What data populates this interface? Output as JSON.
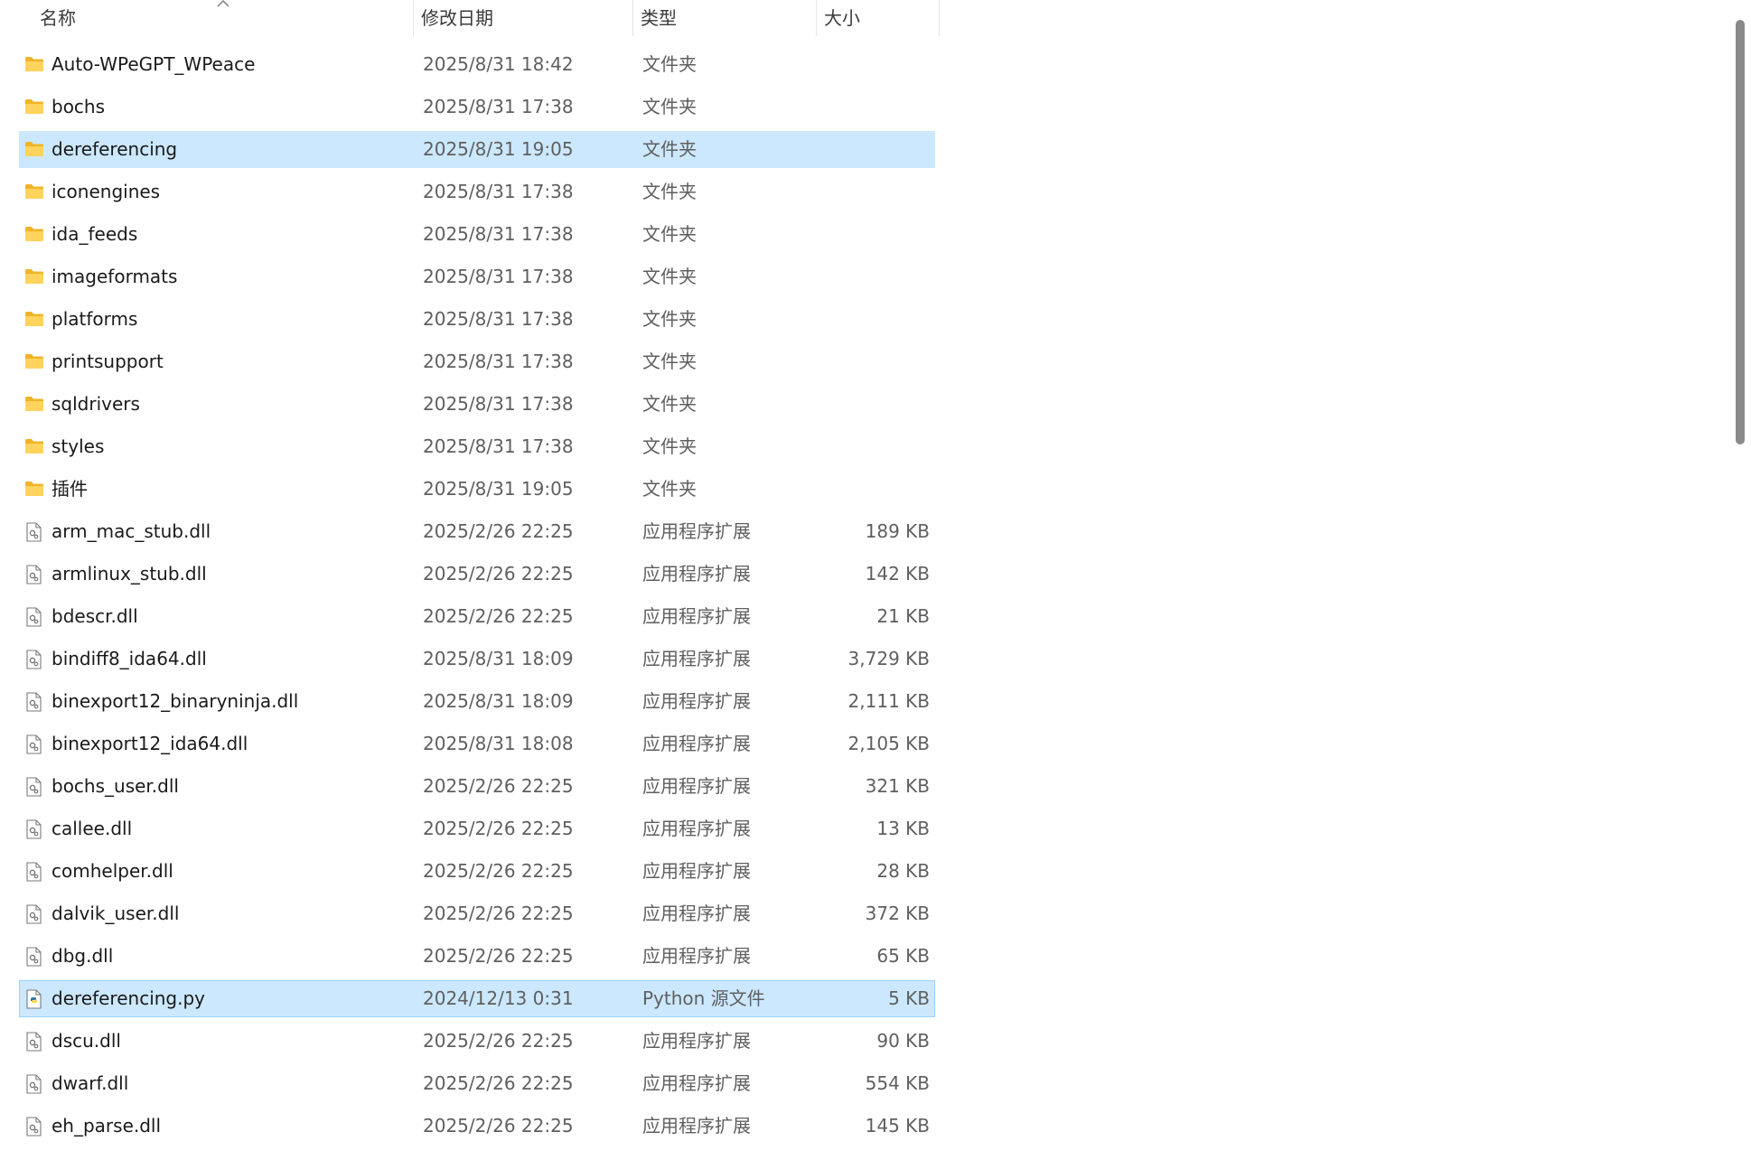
{
  "columns": {
    "name": "名称",
    "date": "修改日期",
    "type": "类型",
    "size": "大小"
  },
  "files": [
    {
      "name": "Auto-WPeGPT_WPeace",
      "date": "2025/8/31 18:42",
      "type": "文件夹",
      "size": "",
      "icon": "folder-icon",
      "state": ""
    },
    {
      "name": "bochs",
      "date": "2025/8/31 17:38",
      "type": "文件夹",
      "size": "",
      "icon": "folder-icon",
      "state": ""
    },
    {
      "name": "dereferencing",
      "date": "2025/8/31 19:05",
      "type": "文件夹",
      "size": "",
      "icon": "folder-icon",
      "state": "selected"
    },
    {
      "name": "iconengines",
      "date": "2025/8/31 17:38",
      "type": "文件夹",
      "size": "",
      "icon": "folder-icon",
      "state": ""
    },
    {
      "name": "ida_feeds",
      "date": "2025/8/31 17:38",
      "type": "文件夹",
      "size": "",
      "icon": "folder-icon",
      "state": ""
    },
    {
      "name": "imageformats",
      "date": "2025/8/31 17:38",
      "type": "文件夹",
      "size": "",
      "icon": "folder-icon",
      "state": ""
    },
    {
      "name": "platforms",
      "date": "2025/8/31 17:38",
      "type": "文件夹",
      "size": "",
      "icon": "folder-icon",
      "state": ""
    },
    {
      "name": "printsupport",
      "date": "2025/8/31 17:38",
      "type": "文件夹",
      "size": "",
      "icon": "folder-icon",
      "state": ""
    },
    {
      "name": "sqldrivers",
      "date": "2025/8/31 17:38",
      "type": "文件夹",
      "size": "",
      "icon": "folder-icon",
      "state": ""
    },
    {
      "name": "styles",
      "date": "2025/8/31 17:38",
      "type": "文件夹",
      "size": "",
      "icon": "folder-icon",
      "state": ""
    },
    {
      "name": "插件",
      "date": "2025/8/31 19:05",
      "type": "文件夹",
      "size": "",
      "icon": "folder-icon",
      "state": ""
    },
    {
      "name": "arm_mac_stub.dll",
      "date": "2025/2/26 22:25",
      "type": "应用程序扩展",
      "size": "189 KB",
      "icon": "dll-file-icon",
      "state": ""
    },
    {
      "name": "armlinux_stub.dll",
      "date": "2025/2/26 22:25",
      "type": "应用程序扩展",
      "size": "142 KB",
      "icon": "dll-file-icon",
      "state": ""
    },
    {
      "name": "bdescr.dll",
      "date": "2025/2/26 22:25",
      "type": "应用程序扩展",
      "size": "21 KB",
      "icon": "dll-file-icon",
      "state": ""
    },
    {
      "name": "bindiff8_ida64.dll",
      "date": "2025/8/31 18:09",
      "type": "应用程序扩展",
      "size": "3,729 KB",
      "icon": "dll-file-icon",
      "state": ""
    },
    {
      "name": "binexport12_binaryninja.dll",
      "date": "2025/8/31 18:09",
      "type": "应用程序扩展",
      "size": "2,111 KB",
      "icon": "dll-file-icon",
      "state": ""
    },
    {
      "name": "binexport12_ida64.dll",
      "date": "2025/8/31 18:08",
      "type": "应用程序扩展",
      "size": "2,105 KB",
      "icon": "dll-file-icon",
      "state": ""
    },
    {
      "name": "bochs_user.dll",
      "date": "2025/2/26 22:25",
      "type": "应用程序扩展",
      "size": "321 KB",
      "icon": "dll-file-icon",
      "state": ""
    },
    {
      "name": "callee.dll",
      "date": "2025/2/26 22:25",
      "type": "应用程序扩展",
      "size": "13 KB",
      "icon": "dll-file-icon",
      "state": ""
    },
    {
      "name": "comhelper.dll",
      "date": "2025/2/26 22:25",
      "type": "应用程序扩展",
      "size": "28 KB",
      "icon": "dll-file-icon",
      "state": ""
    },
    {
      "name": "dalvik_user.dll",
      "date": "2025/2/26 22:25",
      "type": "应用程序扩展",
      "size": "372 KB",
      "icon": "dll-file-icon",
      "state": ""
    },
    {
      "name": "dbg.dll",
      "date": "2025/2/26 22:25",
      "type": "应用程序扩展",
      "size": "65 KB",
      "icon": "dll-file-icon",
      "state": ""
    },
    {
      "name": "dereferencing.py",
      "date": "2024/12/13 0:31",
      "type": "Python 源文件",
      "size": "5 KB",
      "icon": "python-file-icon",
      "state": "focused"
    },
    {
      "name": "dscu.dll",
      "date": "2025/2/26 22:25",
      "type": "应用程序扩展",
      "size": "90 KB",
      "icon": "dll-file-icon",
      "state": ""
    },
    {
      "name": "dwarf.dll",
      "date": "2025/2/26 22:25",
      "type": "应用程序扩展",
      "size": "554 KB",
      "icon": "dll-file-icon",
      "state": ""
    },
    {
      "name": "eh_parse.dll",
      "date": "2025/2/26 22:25",
      "type": "应用程序扩展",
      "size": "145 KB",
      "icon": "dll-file-icon",
      "state": ""
    }
  ],
  "colors": {
    "selection": "#cce8ff",
    "focus_border": "#99d1ff",
    "folder": "#ffd35c",
    "folder_dark": "#f0b429"
  }
}
